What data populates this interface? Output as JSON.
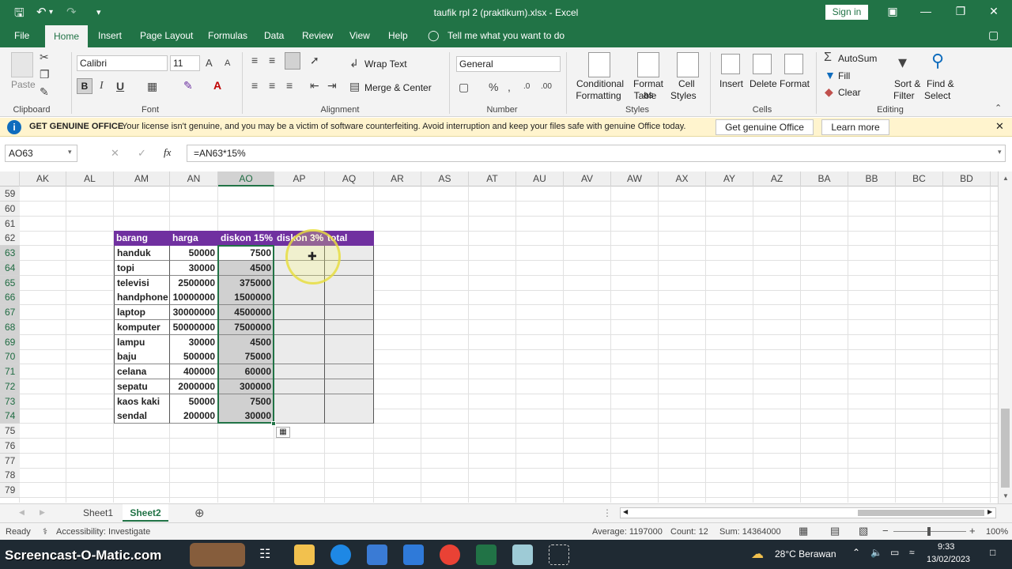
{
  "titlebar": {
    "title": "taufik rpl 2 (praktikum).xlsx  -  Excel",
    "signin": "Sign in"
  },
  "tabs": [
    "File",
    "Home",
    "Insert",
    "Page Layout",
    "Formulas",
    "Data",
    "Review",
    "View",
    "Help"
  ],
  "tell_me": "Tell me what you want to do",
  "ribbon": {
    "clipboard": {
      "paste": "Paste",
      "label": "Clipboard"
    },
    "font": {
      "name": "Calibri",
      "size": "11",
      "label": "Font",
      "bold": "B",
      "italic": "I",
      "underline": "U"
    },
    "alignment": {
      "wrap": "Wrap Text",
      "merge": "Merge & Center",
      "label": "Alignment"
    },
    "number": {
      "format": "General",
      "label": "Number"
    },
    "styles": {
      "conditional": "Conditional",
      "conditional2": "Formatting",
      "format_as": "Format as",
      "format_as2": "Table",
      "cell": "Cell",
      "cell2": "Styles",
      "label": "Styles"
    },
    "cells": {
      "insert": "Insert",
      "delete": "Delete",
      "format": "Format",
      "label": "Cells"
    },
    "editing": {
      "autosum": "AutoSum",
      "fill": "Fill",
      "clear": "Clear",
      "sort": "Sort &",
      "sort2": "Filter",
      "find": "Find &",
      "find2": "Select",
      "label": "Editing"
    }
  },
  "warning": {
    "title": "GET GENUINE OFFICE",
    "message": "Your license isn't genuine, and you may be a victim of software counterfeiting. Avoid interruption and keep your files safe with genuine Office today.",
    "btn1": "Get genuine Office",
    "btn2": "Learn more"
  },
  "formula_bar": {
    "name": "AO63",
    "formula": "=AN63*15%",
    "fx": "fx"
  },
  "columns": [
    "AK",
    "AL",
    "AM",
    "AN",
    "AO",
    "AP",
    "AQ",
    "AR",
    "AS",
    "AT",
    "AU",
    "AV",
    "AW",
    "AX",
    "AY",
    "AZ",
    "BA",
    "BB",
    "BC",
    "BD"
  ],
  "rows": [
    "59",
    "60",
    "61",
    "62",
    "63",
    "64",
    "65",
    "66",
    "67",
    "68",
    "69",
    "70",
    "71",
    "72",
    "73",
    "74",
    "75",
    "76",
    "77",
    "78",
    "79"
  ],
  "table": {
    "headers": [
      "barang",
      "harga",
      "diskon 15%",
      "diskon 3%",
      "total"
    ],
    "rows": [
      [
        "handuk",
        "50000",
        "7500"
      ],
      [
        "topi",
        "30000",
        "4500"
      ],
      [
        "televisi",
        "2500000",
        "375000"
      ],
      [
        "handphone",
        "10000000",
        "1500000"
      ],
      [
        "laptop",
        "30000000",
        "4500000"
      ],
      [
        "komputer",
        "50000000",
        "7500000"
      ],
      [
        "lampu",
        "30000",
        "4500"
      ],
      [
        "baju",
        "500000",
        "75000"
      ],
      [
        "celana",
        "400000",
        "60000"
      ],
      [
        "sepatu",
        "2000000",
        "300000"
      ],
      [
        "kaos kaki",
        "50000",
        "7500"
      ],
      [
        "sendal",
        "200000",
        "30000"
      ]
    ]
  },
  "sheets": [
    "Sheet1",
    "Sheet2"
  ],
  "status": {
    "ready": "Ready",
    "accessibility": "Accessibility: Investigate",
    "average": "Average: 1197000",
    "count": "Count: 12",
    "sum": "Sum: 14364000",
    "zoom": "100%"
  },
  "taskbar": {
    "watermark": "Screencast-O-Matic.com",
    "weather": "28°C  Berawan",
    "time": "9:33",
    "date": "13/02/2023"
  },
  "colors": {
    "excel_green": "#217346",
    "header_purple": "#7030a0",
    "warn_yellow": "#fff4ce"
  }
}
